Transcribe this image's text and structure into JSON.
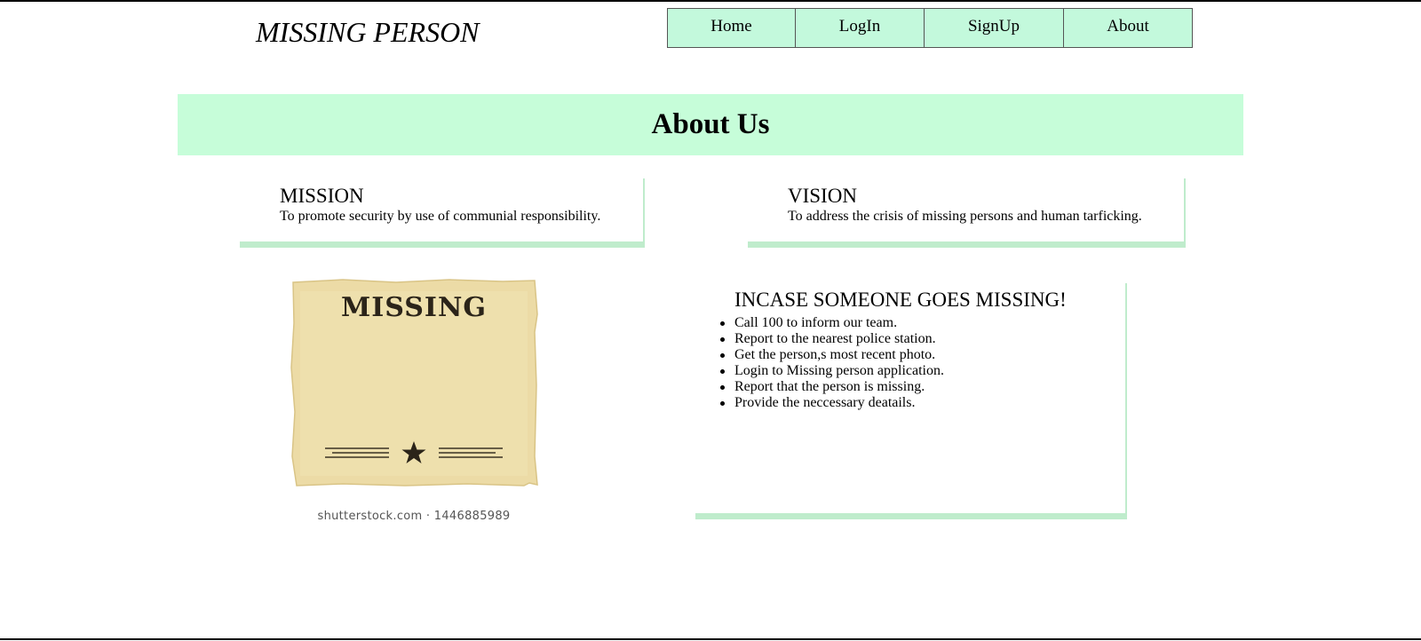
{
  "site": {
    "title": "MISSING PERSON"
  },
  "nav": {
    "items": [
      {
        "label": "Home"
      },
      {
        "label": "LogIn"
      },
      {
        "label": "SignUp"
      },
      {
        "label": "About"
      }
    ]
  },
  "about": {
    "title": "About Us"
  },
  "mission": {
    "heading": "MISSION",
    "text": "To promote security by use of communial responsibility."
  },
  "vision": {
    "heading": "VISION",
    "text": "To address the crisis of missing persons and human tarficking."
  },
  "poster": {
    "headline": "MISSING",
    "caption": "shutterstock.com · 1446885989"
  },
  "missing_steps": {
    "heading": "INCASE SOMEONE GOES MISSING!",
    "items": [
      "Call 100 to inform our team.",
      "Report to the nearest police station.",
      "Get the person,s most recent photo.",
      "Login to Missing person application.",
      "Report that the person is missing.",
      "Provide the neccessary deatails."
    ]
  },
  "colors": {
    "nav_background": "#c3f9dc",
    "banner_background": "#c6fdd9",
    "card_shadow": "#bfeccc",
    "poster_paper": "#ecdba6"
  }
}
